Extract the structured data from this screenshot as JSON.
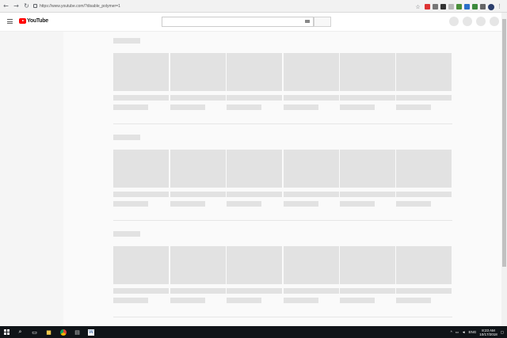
{
  "browser": {
    "url": "https://www.youtube.com/?disable_polymer=1",
    "nav_icons": [
      "back-icon",
      "forward-icon",
      "reload-icon"
    ],
    "extensions": [
      "star-icon",
      "ext-red",
      "ext-gray",
      "ext-dark",
      "ext-bookmark",
      "ext-green",
      "ext-blue",
      "ext-check",
      "ext-ghost"
    ],
    "profile": "profile-avatar"
  },
  "youtube": {
    "logo_text": "YouTube",
    "icons": [
      "menu-icon",
      "keyboard-icon"
    ]
  },
  "taskbar": {
    "time": "8:23 AM",
    "date": "10/17/2018",
    "language": "ENG",
    "apps": [
      "search-icon",
      "task-view-icon",
      "explorer-icon",
      "chrome-icon",
      "store-icon",
      "word-icon"
    ]
  },
  "colors": {
    "youtube_red": "#ff0000",
    "skeleton": "#e2e2e2",
    "taskbar": "#101418"
  }
}
